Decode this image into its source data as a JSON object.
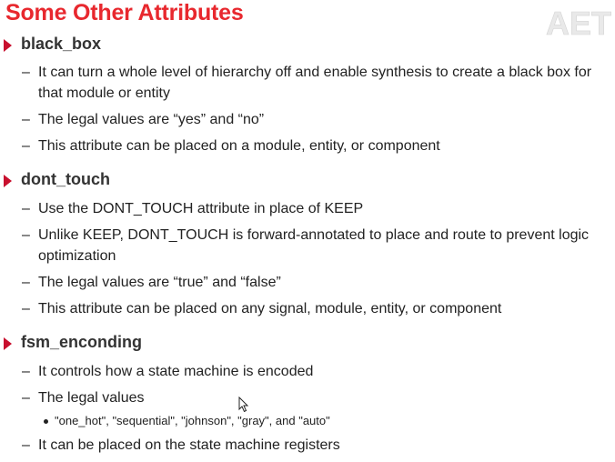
{
  "slide": {
    "title": "Some Other Attributes",
    "logo_text": "AET",
    "accent_color": "#e8282e",
    "sections": [
      {
        "label": "black_box",
        "bullets": [
          "It can turn a whole level of hierarchy off and enable synthesis to create a black box for that module or entity",
          "The legal values are “yes” and “no”",
          "This attribute can be placed on a module, entity, or component"
        ]
      },
      {
        "label": "dont_touch",
        "bullets": [
          "Use the DONT_TOUCH attribute in place of KEEP",
          "Unlike KEEP, DONT_TOUCH is forward-annotated to place and route to prevent logic optimization",
          "The legal values are “true” and “false”",
          "This attribute can be placed on any signal, module, entity, or component"
        ]
      },
      {
        "label": "fsm_enconding",
        "bullets": [
          "It controls how a state machine is encoded",
          "The legal values",
          "It can be placed on the state machine registers"
        ],
        "sub_bullet": "\"one_hot\", \"sequential\", \"johnson\", \"gray\", and \"auto\""
      }
    ]
  }
}
